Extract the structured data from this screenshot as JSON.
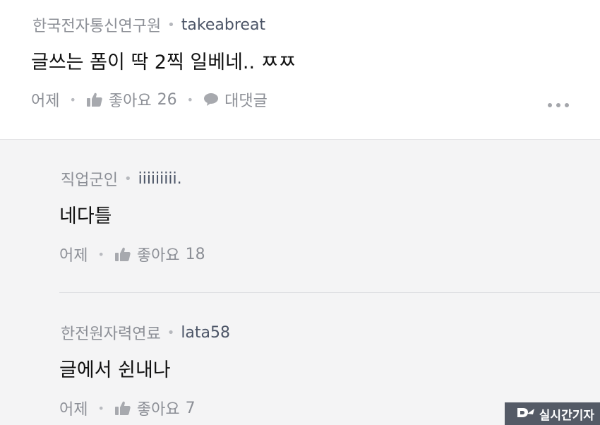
{
  "comments": [
    {
      "affiliation": "한국전자통신연구원",
      "username": "takeabreat",
      "text": "글쓰는 폼이 딱 2찍 일베네.. ㅉㅉ",
      "time": "어제",
      "like_label": "좋아요",
      "like_count": "26",
      "reply_label": "대댓글",
      "icons": {
        "like": "thumbs-up-icon",
        "reply": "speech-bubble-icon",
        "more": "more-dots-icon"
      }
    },
    {
      "affiliation": "직업군인",
      "username": "iiiiiiiii.",
      "text": "네다틀",
      "time": "어제",
      "like_label": "좋아요",
      "like_count": "18"
    },
    {
      "affiliation": "한전원자력연료",
      "username": "lata58",
      "text": "글에서 쉰내나",
      "time": "어제",
      "like_label": "좋아요",
      "like_count": "7"
    }
  ],
  "watermark": {
    "text": "실시간기자"
  },
  "colors": {
    "top_background": "#ffffff",
    "reply_background": "#f4f4f5",
    "meta_gray": "#8c8f96",
    "username": "#4b5466"
  }
}
